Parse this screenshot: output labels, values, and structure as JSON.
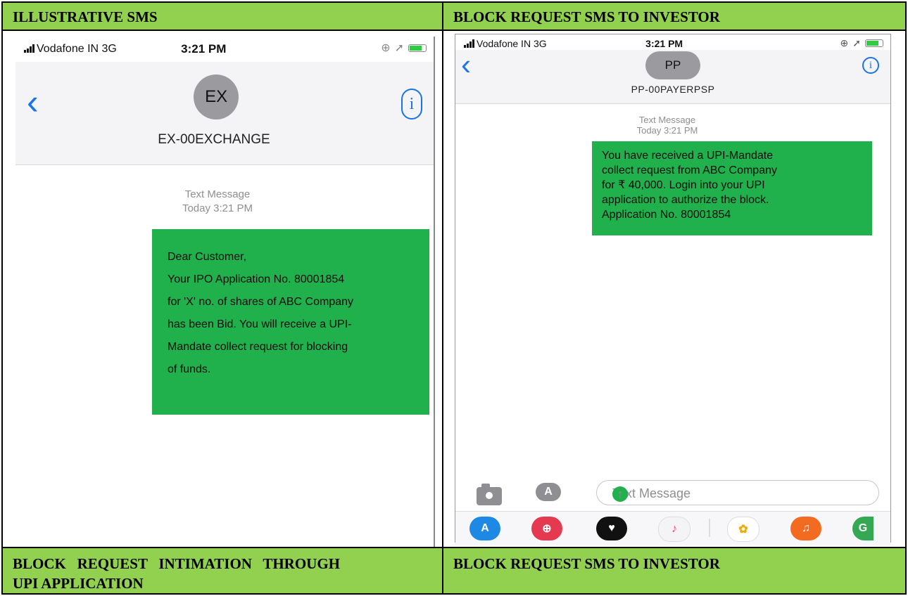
{
  "headers": {
    "top_left": "ILLUSTRATIVE SMS",
    "top_right": "BLOCK REQUEST SMS TO INVESTOR",
    "bottom_left_line1": "BLOCK   REQUEST   INTIMATION   THROUGH",
    "bottom_left_line2": "UPI APPLICATION",
    "bottom_right": "BLOCK REQUEST SMS TO INVESTOR"
  },
  "left_phone": {
    "carrier": "Vodafone IN  3G",
    "time": "3:21 PM",
    "avatar_initials": "EX",
    "contact_name": "EX-00EXCHANGE",
    "meta_line1": "Text Message",
    "meta_line2": "Today 3:21 PM",
    "message_lines": [
      "Dear Customer,",
      "Your IPO Application No. 80001854",
      "for 'X' no. of shares of ABC Company",
      "has been Bid. You will receive a UPI-",
      "Mandate collect request for blocking",
      "of funds."
    ],
    "icons": [
      "back-chevron-icon",
      "info-icon",
      "signal-icon",
      "location-icon",
      "battery-icon"
    ]
  },
  "right_phone": {
    "carrier": "Vodafone IN  3G",
    "time": "3:21 PM",
    "avatar_initials": "PP",
    "contact_name": "PP-00PAYERPSP",
    "meta_line1": "Text Message",
    "meta_line2": "Today 3:21 PM",
    "message_lines": [
      "You have received a UPI-Mandate",
      "collect request from ABC Company",
      "for ₹ 40,000. Login into your UPI",
      "application to authorize the block.",
      "Application No. 80001854"
    ],
    "input_placeholder": "Text Message",
    "icons": [
      "camera-icon",
      "app-store-icon",
      "send-arrow-icon"
    ]
  },
  "colors": {
    "header_green": "#92d050",
    "bubble_green": "#21b14c",
    "ios_blue": "#1a73e8"
  }
}
